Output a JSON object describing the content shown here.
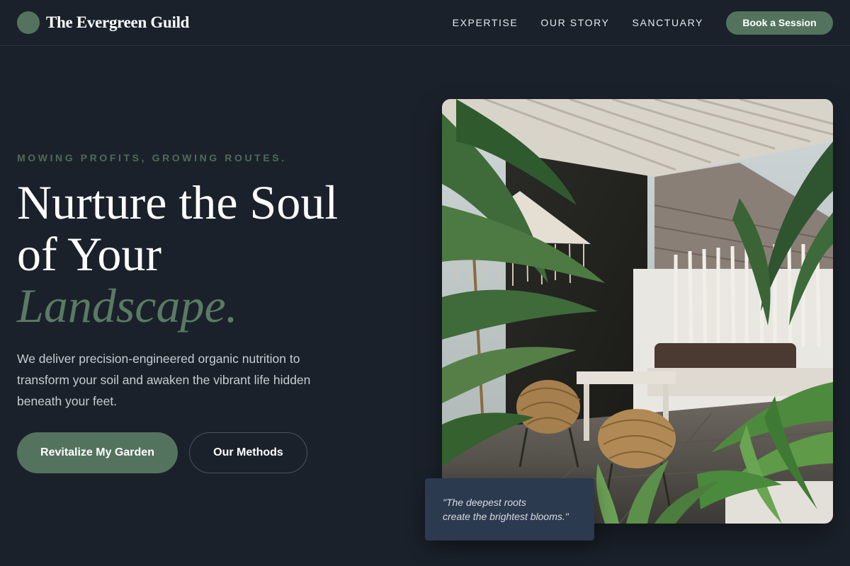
{
  "brand": {
    "name": "The Evergreen Guild"
  },
  "nav": {
    "links": [
      "EXPERTISE",
      "OUR STORY",
      "SANCTUARY"
    ],
    "cta": "Book a Session"
  },
  "hero": {
    "eyebrow": "MOWING PROFITS, GROWING ROUTES.",
    "headline_line1": "Nurture the Soul",
    "headline_line2": "of Your",
    "headline_accent": "Landscape.",
    "lead": "We deliver precision-engineered organic nutrition to transform your soil and awaken the vibrant life hidden beneath your feet.",
    "primary_button": "Revitalize My Garden",
    "secondary_button": "Our Methods"
  },
  "quote": {
    "line1": "\"The deepest roots",
    "line2": "create the brightest blooms.\""
  },
  "colors": {
    "background": "#1b212b",
    "accent": "#54735e",
    "quote_card": "#2b3a4e"
  }
}
